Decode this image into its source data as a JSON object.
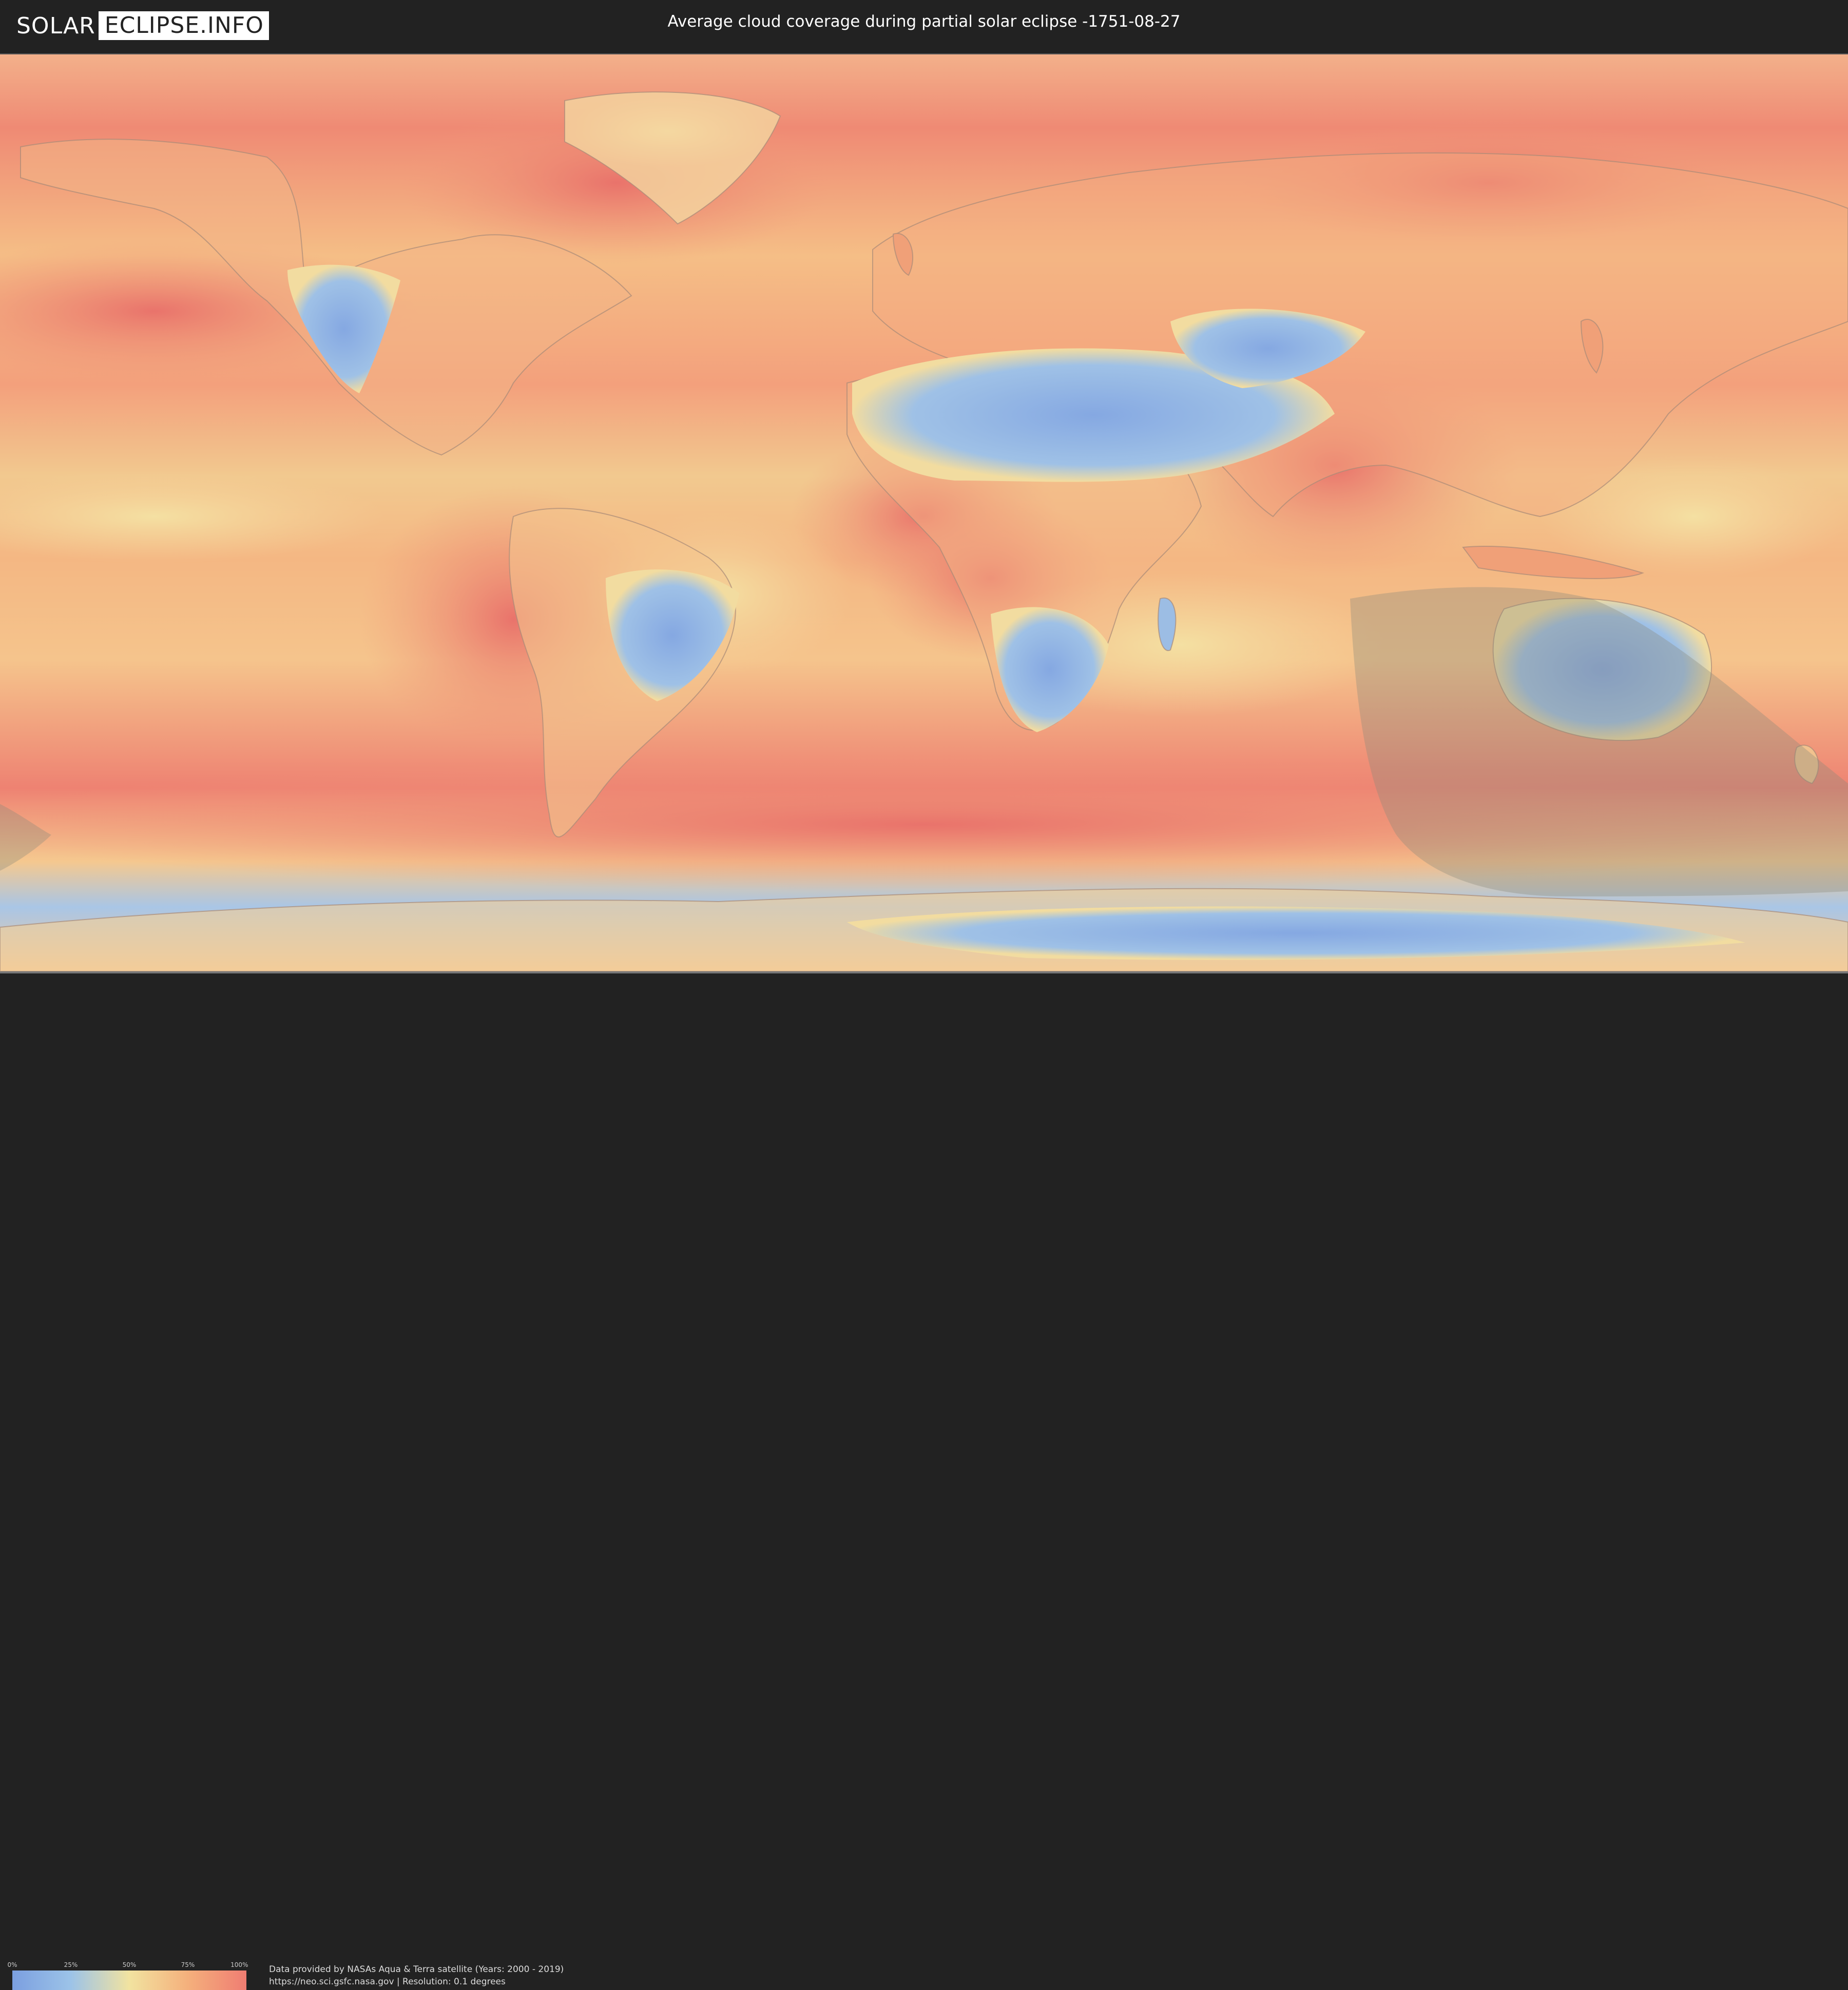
{
  "header": {
    "logo_left": "SOLAR",
    "logo_right": "ECLIPSE.INFO",
    "title": "Average cloud coverage during partial solar eclipse -1751-08-27"
  },
  "legend": {
    "ticks": [
      {
        "label": "0%",
        "value": 0
      },
      {
        "label": "25%",
        "value": 25
      },
      {
        "label": "50%",
        "value": 50
      },
      {
        "label": "75%",
        "value": 75
      },
      {
        "label": "100%",
        "value": 100
      }
    ],
    "colors": [
      "#7b9fe0",
      "#9cc3e8",
      "#f2e3a0",
      "#f4b07c",
      "#f07d72"
    ]
  },
  "credits": {
    "line1": "Data provided by NASAs Aqua & Terra satellite (Years: 2000 - 2019)",
    "line2": "https://neo.sci.gsfc.nasa.gov | Resolution: 0.1 degrees"
  },
  "map": {
    "ocean_color": "#f3a07c",
    "clear_color": "#8fb2e4",
    "mid_color": "#f2dca0",
    "eclipse_shadow_color": "#8a8a7a"
  }
}
